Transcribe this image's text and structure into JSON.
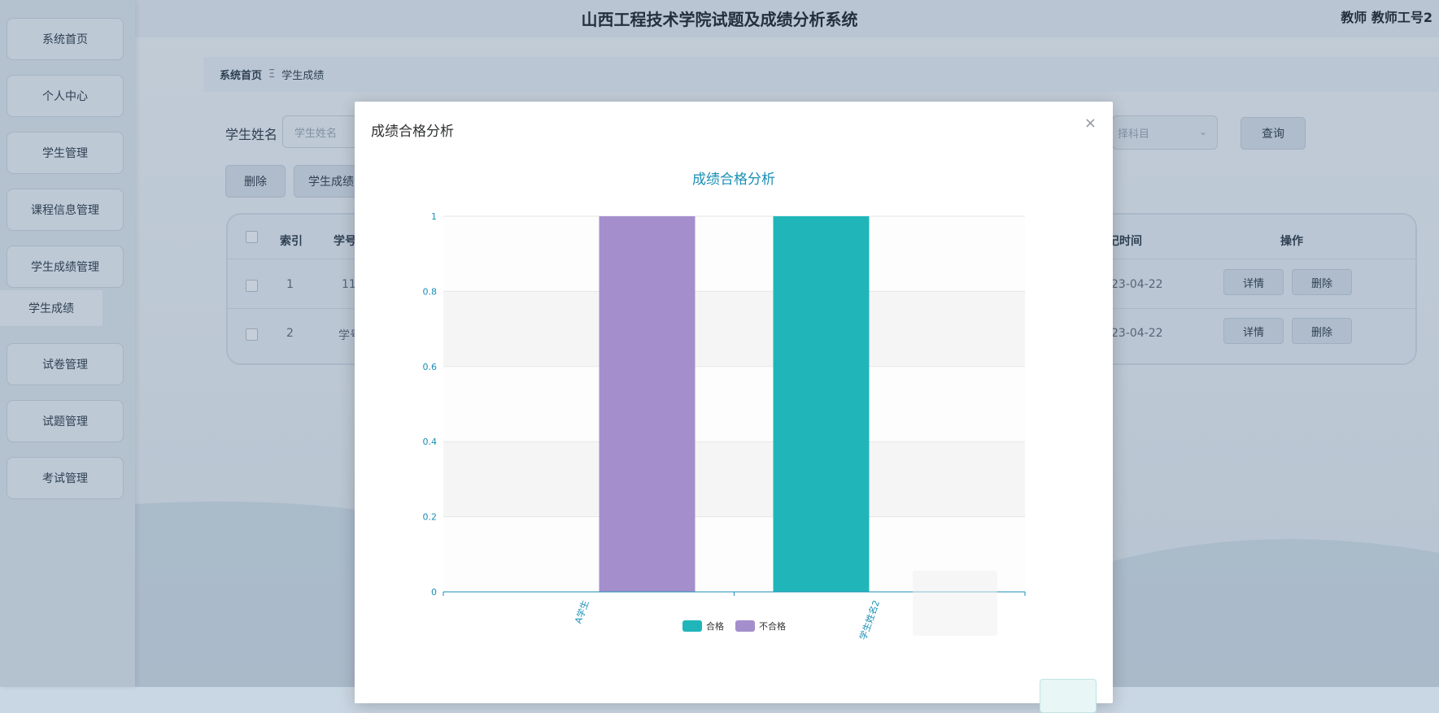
{
  "app": {
    "title": "山西工程技术学院试题及成绩分析系统",
    "user": "教师 教师工号2"
  },
  "sidebar": {
    "items": [
      {
        "label": "系统首页"
      },
      {
        "label": "个人中心"
      },
      {
        "label": "学生管理"
      },
      {
        "label": "课程信息管理"
      },
      {
        "label": "学生成绩管理"
      },
      {
        "label": "试卷管理"
      },
      {
        "label": "试题管理"
      },
      {
        "label": "考试管理"
      }
    ],
    "sub_item": "学生成绩"
  },
  "breadcrumb": {
    "home": "系统首页",
    "sep": "Ξ",
    "current": "学生成绩"
  },
  "search": {
    "label": "学生姓名",
    "placeholder": "学生姓名",
    "subject_placeholder": "择科目",
    "query_button": "查询"
  },
  "toolbar": {
    "delete": "删除",
    "export": "学生成绩"
  },
  "table": {
    "headers": {
      "index": "索引",
      "id": "学号",
      "time": "记时间",
      "ops": "操作"
    },
    "rows": [
      {
        "index": "1",
        "id": "11",
        "time": "23-04-22"
      },
      {
        "index": "2",
        "id": "学号",
        "time": "23-04-22"
      }
    ],
    "detail_label": "详情",
    "delete_label": "删除"
  },
  "modal": {
    "title": "成绩合格分析",
    "close": "×"
  },
  "chart_data": {
    "type": "bar",
    "title": "成绩合格分析",
    "categories": [
      "A学生",
      "学生姓名2"
    ],
    "series": [
      {
        "name": "合格",
        "values": [
          0,
          1
        ],
        "color": "#20b6b9"
      },
      {
        "name": "不合格",
        "values": [
          1,
          0
        ],
        "color": "#a48fcc"
      }
    ],
    "ylim": [
      0,
      1
    ],
    "yticks": [
      0,
      0.2,
      0.4,
      0.6,
      0.8,
      1
    ],
    "ytick_labels": [
      "0",
      "0.2",
      "0.4",
      "0.6",
      "0.8",
      "1"
    ],
    "legend": "bottom-center",
    "grid": true,
    "axis_color": "#1a8fb5"
  }
}
